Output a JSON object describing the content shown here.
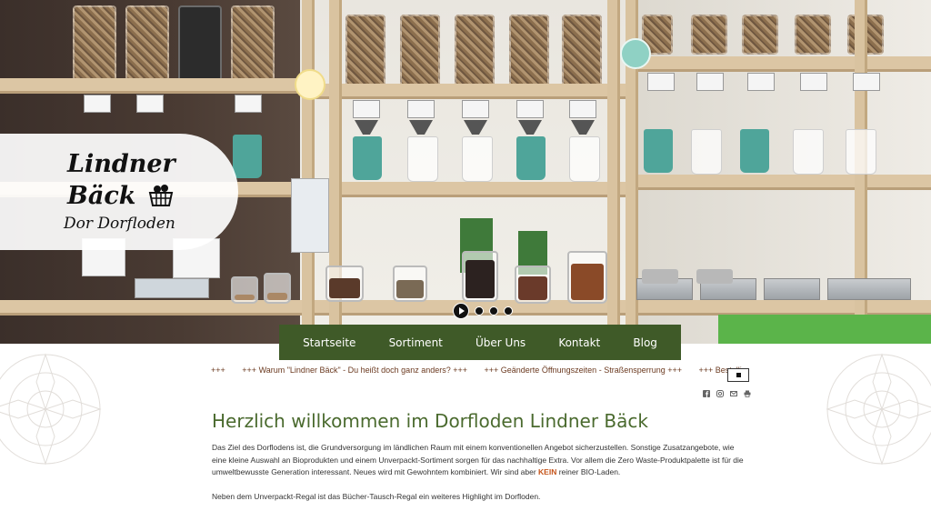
{
  "logo": {
    "line1": "Lindner",
    "line2": "Bäck",
    "line3": "Dor Dorfloden"
  },
  "nav": {
    "items": [
      "Startseite",
      "Sortiment",
      "Über Uns",
      "Kontakt",
      "Blog"
    ]
  },
  "ticker": {
    "items": [
      "+++",
      "+++ Warum \"Lindner Bäck\" - Du heißt doch ganz anders? +++",
      "+++ Geänderte Öffnungszeiten - Straßensperrung +++",
      "+++ Bestelli"
    ]
  },
  "share_icons": [
    "facebook-icon",
    "instagram-icon",
    "mail-icon",
    "print-icon"
  ],
  "content": {
    "title": "Herzlich willkommen im Dorfloden Lindner Bäck",
    "para1_a": "Das Ziel des Dorflodens ist, die Grundversorgung im ländlichen Raum mit einem konventionellen Angebot sicherzustellen. Sonstige Zusatzangebote, wie eine kleine Auswahl an Bioprodukten und einem Unverpackt-Sortiment sorgen für das nachhaltige Extra. Vor allem die Zero Waste-Produktpalette ist für die umweltbewusste Generation interessant. Neues wird mit Gewohntem kombiniert. Wir sind aber ",
    "para1_kein": "KEIN",
    "para1_b": " reiner BIO-Laden.",
    "para2": "Neben dem Unverpackt-Regal ist das Bücher-Tausch-Regal ein weiteres Highlight im Dorfloden."
  },
  "colors": {
    "nav_bg": "#3f5a28",
    "title": "#4a6a2e",
    "ticker_text": "#6b3a20",
    "accent_kein": "#c5541a"
  }
}
